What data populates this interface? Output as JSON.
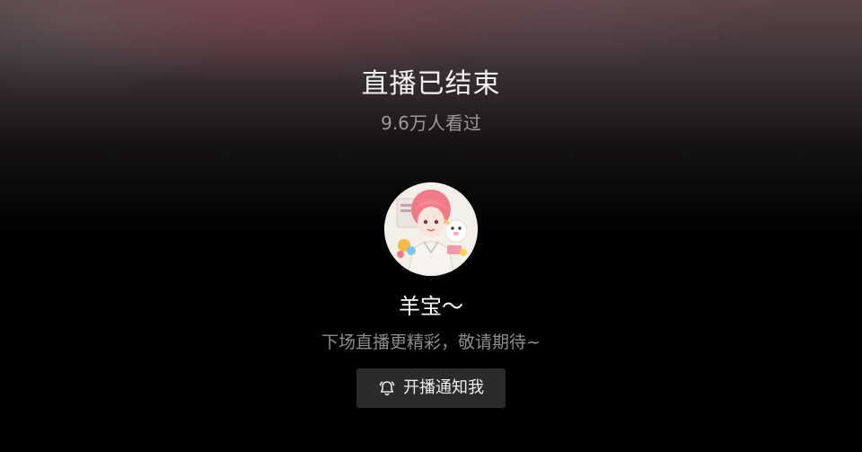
{
  "stream_end": {
    "title": "直播已结束",
    "viewers": "9.6万人看过"
  },
  "streamer": {
    "avatar_icon": "streamer-avatar",
    "name": "羊宝～",
    "tagline": "下场直播更精彩，敬请期待~"
  },
  "notify_button": {
    "icon": "bell-icon",
    "label": "开播通知我"
  },
  "colors": {
    "background": "#000000",
    "button_bg": "#2b2b2b",
    "muted_text": "#8c8c8c"
  }
}
